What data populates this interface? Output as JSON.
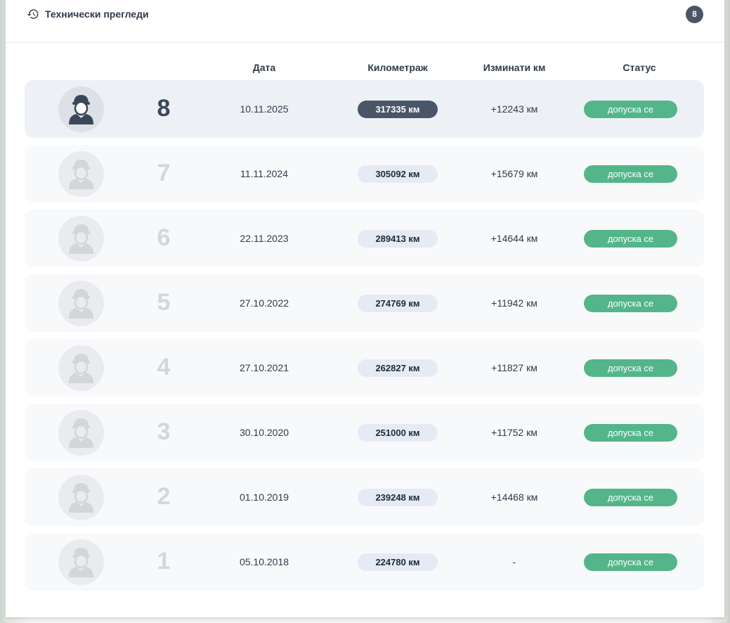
{
  "header": {
    "title": "Технически прегледи",
    "count": "8",
    "icon": "history-icon"
  },
  "columns": {
    "date": "Дата",
    "mileage": "Километраж",
    "delta": "Изминати км",
    "status": "Статус"
  },
  "colors": {
    "accent_dark": "#4a5567",
    "status_green": "#53b589",
    "km_pill": "#e5eaf5"
  },
  "inspections": [
    {
      "number": "8",
      "date": "10.11.2025",
      "km": "317335 км",
      "delta": "+12243 км",
      "status": "допуска се",
      "active": true
    },
    {
      "number": "7",
      "date": "11.11.2024",
      "km": "305092 км",
      "delta": "+15679 км",
      "status": "допуска се",
      "active": false
    },
    {
      "number": "6",
      "date": "22.11.2023",
      "km": "289413 км",
      "delta": "+14644 км",
      "status": "допуска се",
      "active": false
    },
    {
      "number": "5",
      "date": "27.10.2022",
      "km": "274769 км",
      "delta": "+11942 км",
      "status": "допуска се",
      "active": false
    },
    {
      "number": "4",
      "date": "27.10.2021",
      "km": "262827 км",
      "delta": "+11827 км",
      "status": "допуска се",
      "active": false
    },
    {
      "number": "3",
      "date": "30.10.2020",
      "km": "251000 км",
      "delta": "+11752 км",
      "status": "допуска се",
      "active": false
    },
    {
      "number": "2",
      "date": "01.10.2019",
      "km": "239248 км",
      "delta": "+14468 км",
      "status": "допуска се",
      "active": false
    },
    {
      "number": "1",
      "date": "05.10.2018",
      "km": "224780 км",
      "delta": "-",
      "status": "допуска се",
      "active": false
    }
  ]
}
